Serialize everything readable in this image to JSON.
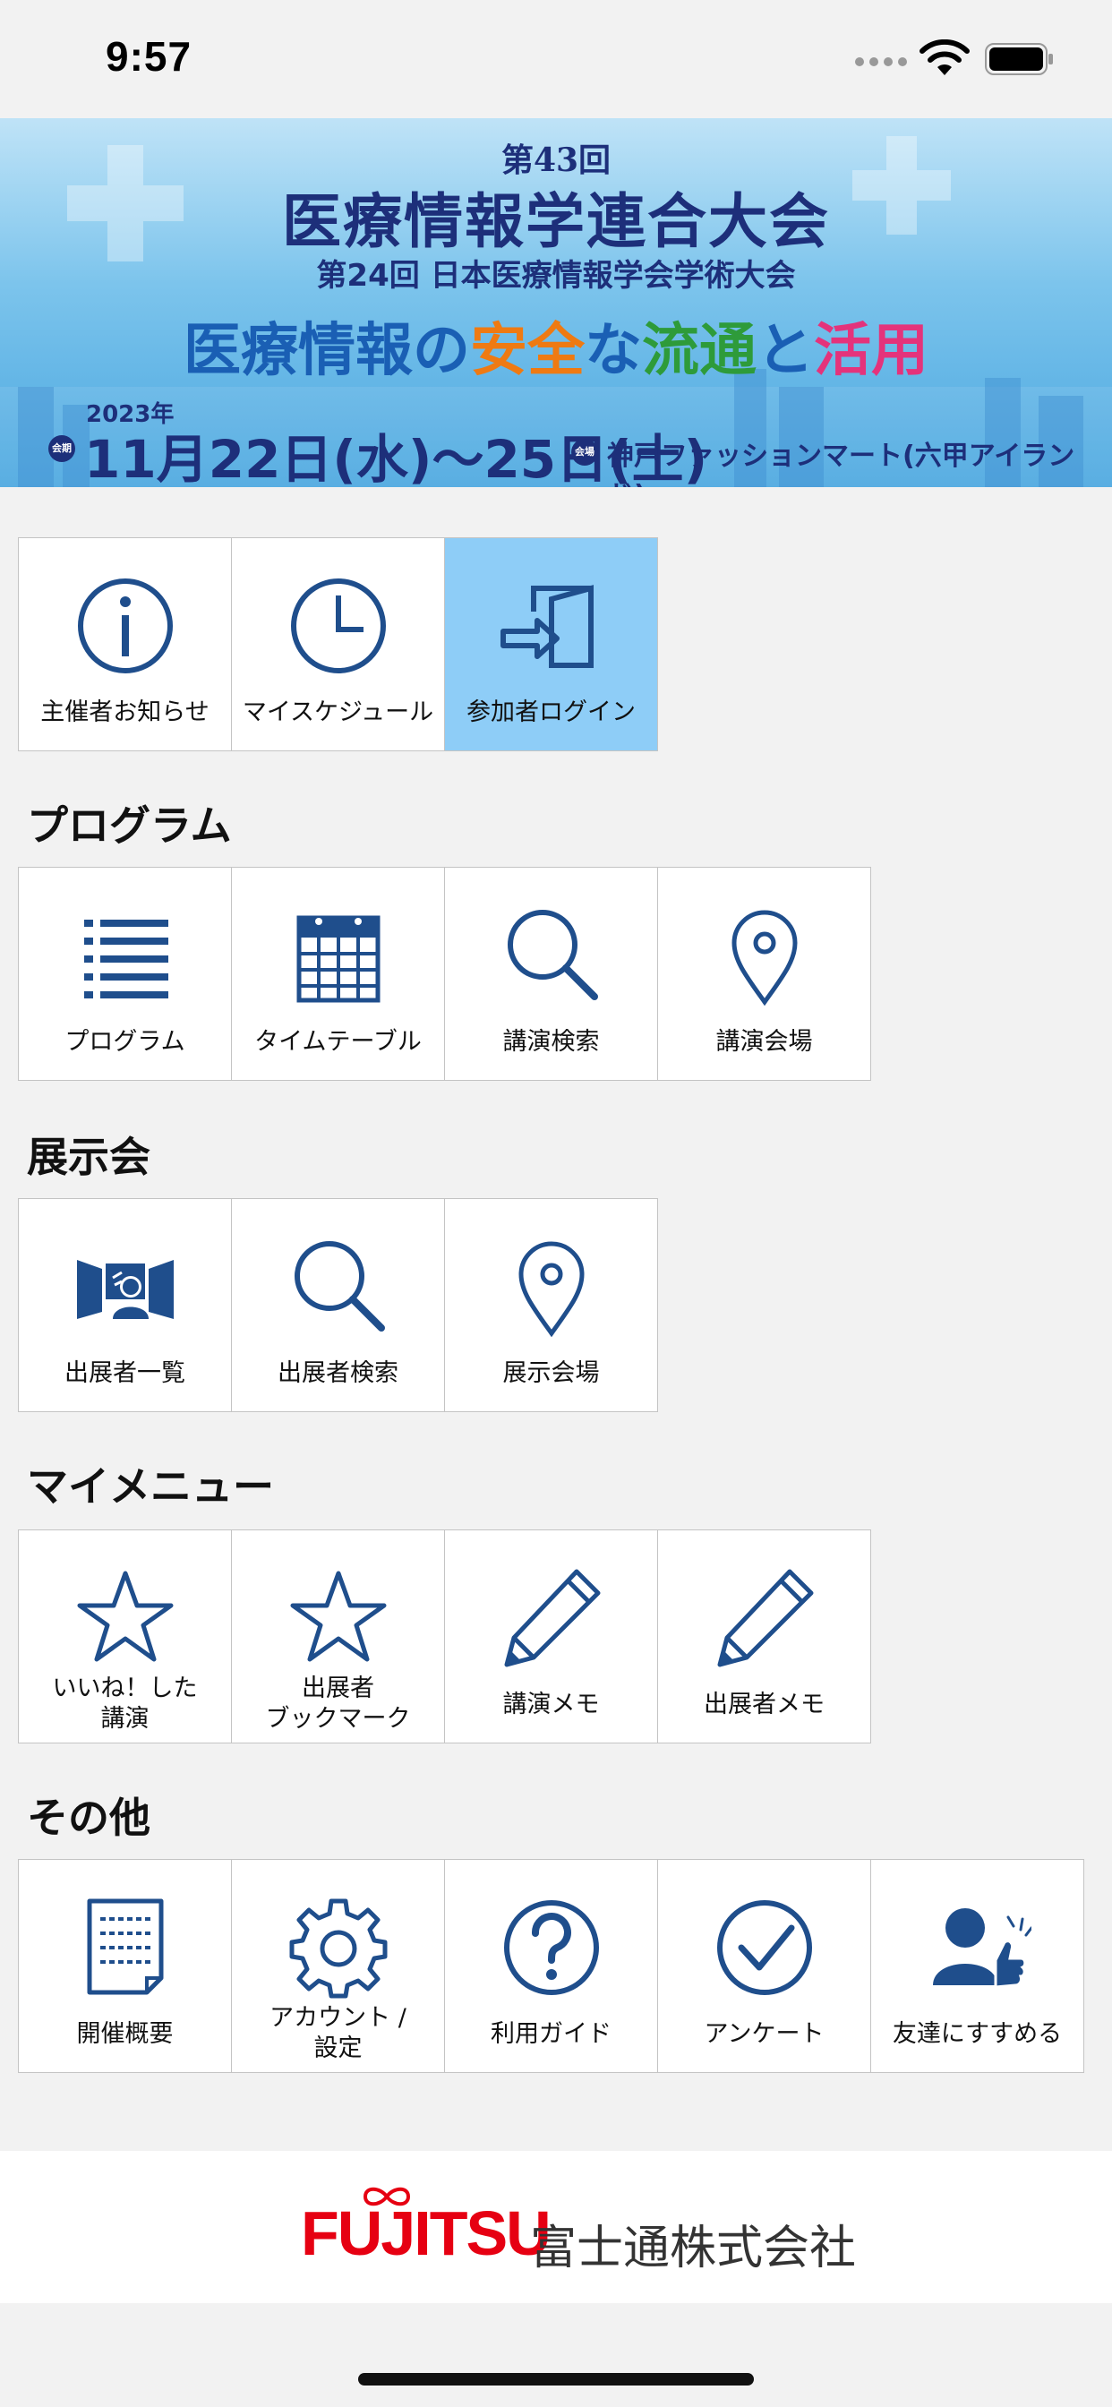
{
  "status": {
    "time": "9:57"
  },
  "banner": {
    "edition": "第43回",
    "title": "医療情報学連合大会",
    "subtitle": "第24回 日本医療情報学会学術大会",
    "theme_part1": "医療情報",
    "theme_part2": "の",
    "theme_part3": "安全",
    "theme_part4": "な",
    "theme_part5": "流通",
    "theme_part6": "と",
    "theme_part7": "活用",
    "year": "2023年",
    "session_badge": "会期",
    "dates": "11月22日(水)〜25日(土)",
    "venue_badge": "会場",
    "venue": "神戸ファッションマート(六甲アイランド)"
  },
  "top_menu": [
    {
      "label": "主催者お知らせ",
      "icon": "info-icon"
    },
    {
      "label": "マイスケジュール",
      "icon": "clock-icon"
    },
    {
      "label": "参加者ログイン",
      "icon": "login-icon"
    }
  ],
  "program": {
    "title": "プログラム",
    "items": [
      {
        "label": "プログラム",
        "icon": "list-icon"
      },
      {
        "label": "タイムテーブル",
        "icon": "calendar-icon"
      },
      {
        "label": "講演検索",
        "icon": "search-icon"
      },
      {
        "label": "講演会場",
        "icon": "map-pin-icon"
      }
    ]
  },
  "exhibition": {
    "title": "展示会",
    "items": [
      {
        "label": "出展者一覧",
        "icon": "exhibitor-icon"
      },
      {
        "label": "出展者検索",
        "icon": "search-icon"
      },
      {
        "label": "展示会場",
        "icon": "map-pin-icon"
      }
    ]
  },
  "my_menu": {
    "title": "マイメニュー",
    "items": [
      {
        "line1": "いいね！した",
        "line2": "講演",
        "icon": "star-icon"
      },
      {
        "line1": "出展者",
        "line2": "ブックマーク",
        "icon": "star-icon"
      },
      {
        "label": "講演メモ",
        "icon": "pencil-icon"
      },
      {
        "label": "出展者メモ",
        "icon": "pencil-icon"
      }
    ]
  },
  "other": {
    "title": "その他",
    "items": [
      {
        "label": "開催概要",
        "icon": "document-icon"
      },
      {
        "line1": "アカウント /",
        "line2": "設定",
        "icon": "gear-icon"
      },
      {
        "label": "利用ガイド",
        "icon": "help-icon"
      },
      {
        "label": "アンケート",
        "icon": "check-circle-icon"
      },
      {
        "label": "友達にすすめる",
        "icon": "recommend-icon"
      }
    ]
  },
  "footer": {
    "logo": "FUJITSU",
    "company": "富士通株式会社"
  },
  "colors": {
    "icon": "#1f4e8c",
    "active_tile": "#8ecdf7",
    "brand_red": "#e60012"
  }
}
